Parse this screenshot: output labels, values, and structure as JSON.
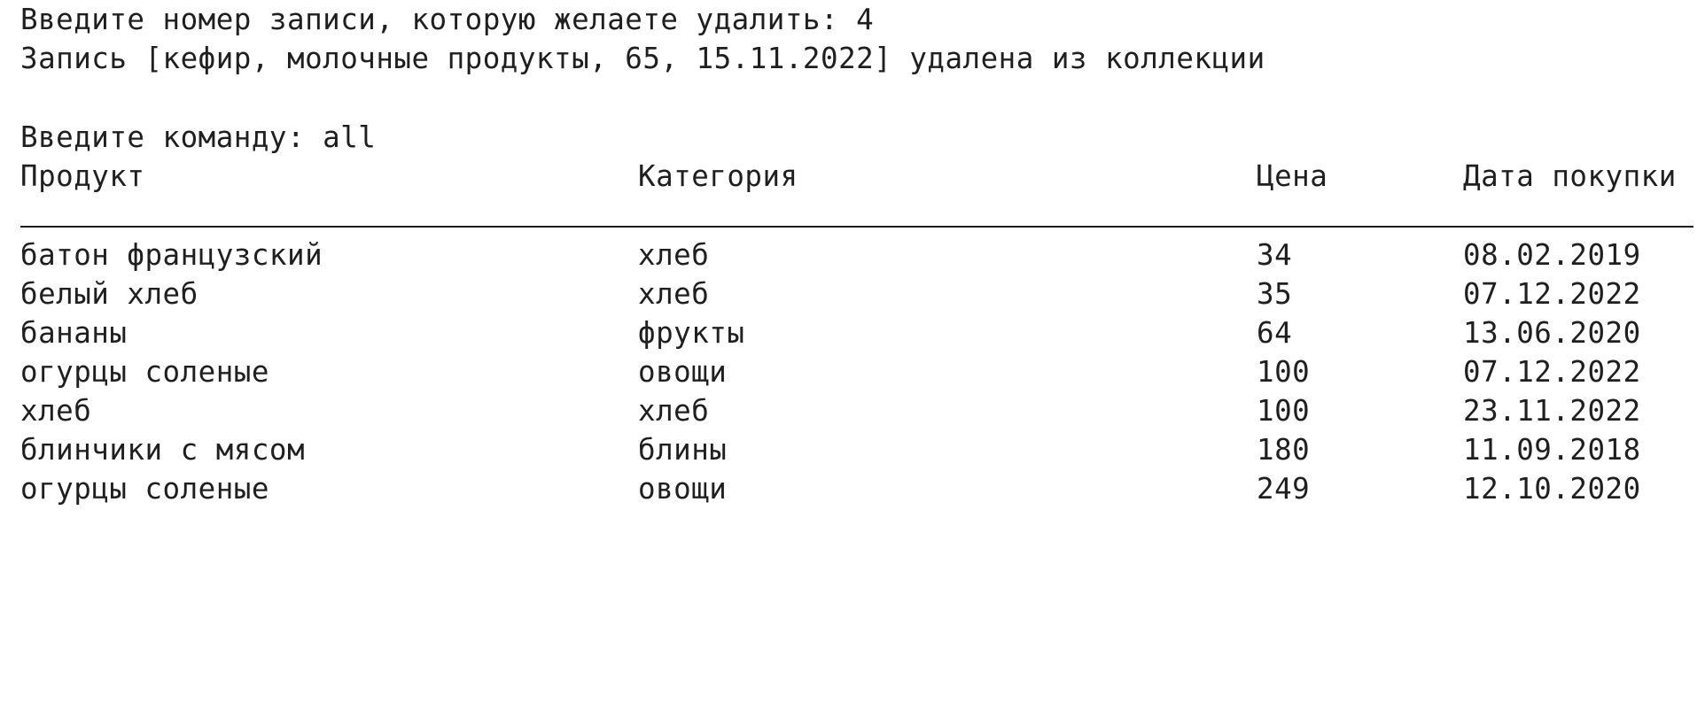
{
  "console": {
    "delete_prompt": "Введите номер записи, которую желаете удалить: 4",
    "delete_result": "Запись [кефир, молочные продукты, 65, 15.11.2022] удалена из коллекции",
    "command_prompt": "Введите команду: all"
  },
  "table": {
    "headers": {
      "product": "Продукт",
      "category": "Категория",
      "price": "Цена",
      "date": "Дата покупки"
    },
    "rows": [
      {
        "product": "батон французский",
        "category": "хлеб",
        "price": "34",
        "date": "08.02.2019"
      },
      {
        "product": "белый хлеб",
        "category": "хлеб",
        "price": "35",
        "date": "07.12.2022"
      },
      {
        "product": "бананы",
        "category": "фрукты",
        "price": "64",
        "date": "13.06.2020"
      },
      {
        "product": "огурцы соленые",
        "category": "овощи",
        "price": "100",
        "date": "07.12.2022"
      },
      {
        "product": "хлеб",
        "category": "хлеб",
        "price": "100",
        "date": "23.11.2022"
      },
      {
        "product": "блинчики с мясом",
        "category": "блины",
        "price": "180",
        "date": "11.09.2018"
      },
      {
        "product": "огурцы соленые",
        "category": "овощи",
        "price": "249",
        "date": "12.10.2020"
      }
    ]
  }
}
